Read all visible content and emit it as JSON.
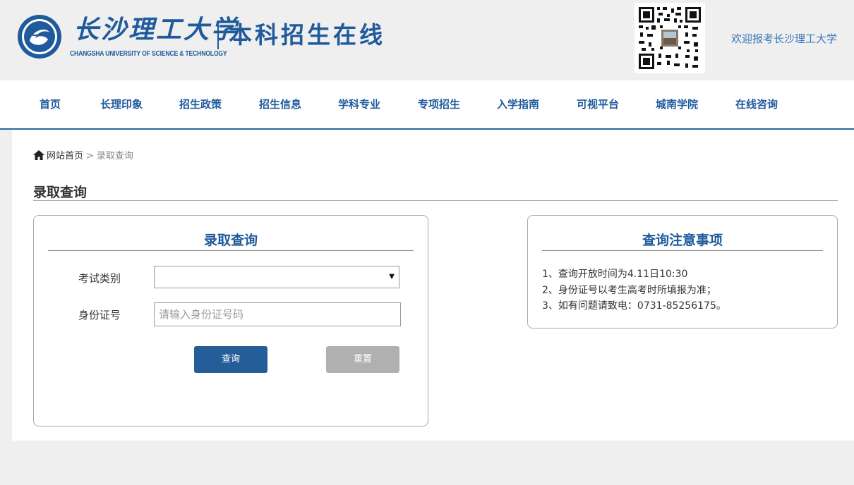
{
  "header": {
    "logo_cn": "长沙理工大学",
    "logo_en": "CHANGSHA UNIVERSITY OF SCIENCE & TECHNOLOGY",
    "logo_sub": "本科招生在线",
    "welcome": "欢迎报考长沙理工大学"
  },
  "nav": {
    "items": [
      "首页",
      "长理印象",
      "招生政策",
      "招生信息",
      "学科专业",
      "专项招生",
      "入学指南",
      "可视平台",
      "城南学院",
      "在线咨询"
    ]
  },
  "breadcrumb": {
    "home": "网站首页",
    "separator": ">",
    "current": "录取查询"
  },
  "page_title": "录取查询",
  "query_panel": {
    "title": "录取查询",
    "exam_type_label": "考试类别",
    "exam_type_value": "",
    "id_label": "身份证号",
    "id_placeholder": "请输入身份证号码",
    "query_button": "查询",
    "reset_button": "重置"
  },
  "notes_panel": {
    "title": "查询注意事项",
    "items": [
      "1、查询开放时间为4.11日10:30",
      "2、身份证号以考生高考时所填报为准；",
      "3、如有问题请致电：0731-85256175。"
    ]
  },
  "colors": {
    "brand_blue": "#1f5a9c",
    "button_blue": "#245d98",
    "button_gray": "#b0b0b0",
    "page_bg": "#efefef"
  },
  "icons": {
    "home": "home-icon",
    "select_arrow": "caret-down-icon",
    "emblem": "university-emblem-icon",
    "qr": "qr-code-icon"
  }
}
